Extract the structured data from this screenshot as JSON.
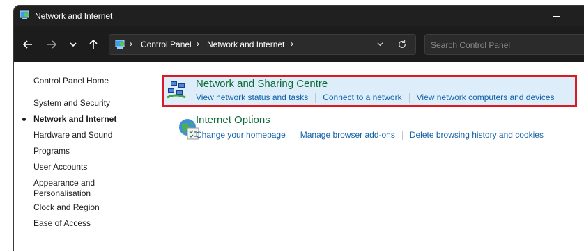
{
  "window": {
    "title": "Network and Internet"
  },
  "navbar": {
    "back_icon": "arrow-left-icon",
    "forward_icon": "arrow-right-icon",
    "recent_icon": "chevron-down-icon",
    "up_icon": "arrow-up-icon",
    "breadcrumb": [
      "Control Panel",
      "Network and Internet"
    ],
    "refresh_icon": "refresh-icon",
    "search_placeholder": "Search Control Panel"
  },
  "sidebar": {
    "home": "Control Panel Home",
    "items": [
      {
        "label": "System and Security",
        "active": false
      },
      {
        "label": "Network and Internet",
        "active": true
      },
      {
        "label": "Hardware and Sound",
        "active": false
      },
      {
        "label": "Programs",
        "active": false
      },
      {
        "label": "User Accounts",
        "active": false
      },
      {
        "label": "Appearance and Personalisation",
        "active": false
      },
      {
        "label": "Clock and Region",
        "active": false
      },
      {
        "label": "Ease of Access",
        "active": false
      }
    ]
  },
  "categories": [
    {
      "title": "Network and Sharing Centre",
      "icon": "network-sharing-icon",
      "highlighted": true,
      "links": [
        "View network status and tasks",
        "Connect to a network",
        "View network computers and devices"
      ]
    },
    {
      "title": "Internet Options",
      "icon": "internet-options-icon",
      "highlighted": false,
      "links": [
        "Change your homepage",
        "Manage browser add-ons",
        "Delete browsing history and cookies"
      ]
    }
  ],
  "colors": {
    "title_bar": "#202020",
    "nav_bar": "#1c1c1c",
    "category_title": "#0e6b37",
    "link": "#1261a8",
    "highlight_fill": "#ddeefa",
    "highlight_border": "#dc1a24"
  }
}
